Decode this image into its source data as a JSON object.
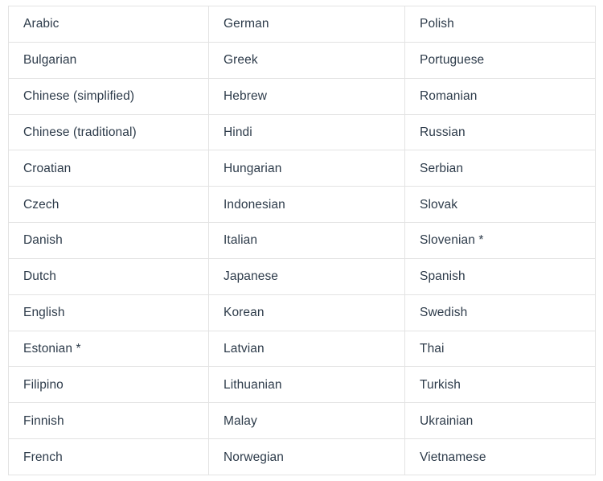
{
  "table": {
    "columns": 3,
    "rows": 13,
    "text_color": "#2d3b4a",
    "border_color": "#e3e3e3",
    "background_color": "#ffffff",
    "cells": [
      [
        "Arabic",
        "German",
        "Polish"
      ],
      [
        "Bulgarian",
        "Greek",
        "Portuguese"
      ],
      [
        "Chinese (simplified)",
        "Hebrew",
        "Romanian"
      ],
      [
        "Chinese (traditional)",
        "Hindi",
        "Russian"
      ],
      [
        "Croatian",
        "Hungarian",
        "Serbian"
      ],
      [
        "Czech",
        "Indonesian",
        "Slovak"
      ],
      [
        "Danish",
        "Italian",
        "Slovenian *"
      ],
      [
        "Dutch",
        "Japanese",
        "Spanish"
      ],
      [
        "English",
        "Korean",
        "Swedish"
      ],
      [
        "Estonian *",
        "Latvian",
        "Thai"
      ],
      [
        "Filipino",
        "Lithuanian",
        "Turkish"
      ],
      [
        "Finnish",
        "Malay",
        "Ukrainian"
      ],
      [
        "French",
        "Norwegian",
        "Vietnamese"
      ]
    ]
  }
}
